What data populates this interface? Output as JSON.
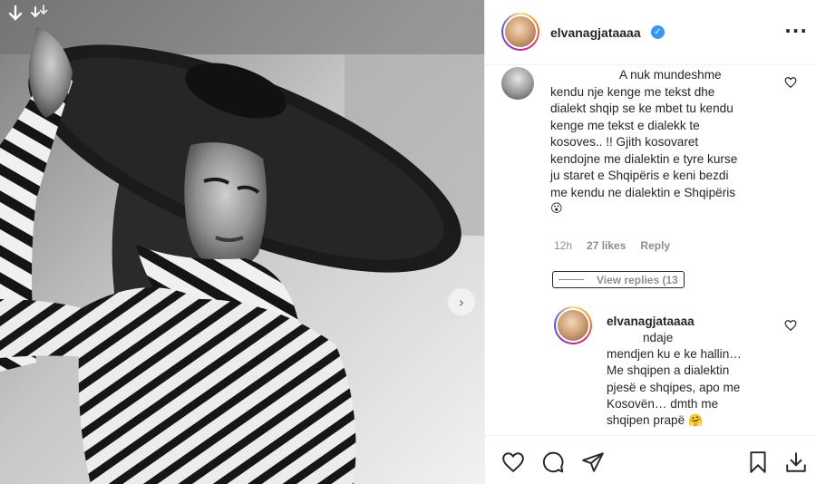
{
  "post": {
    "username": "elvanagjataaaa",
    "verified_icon": "verified-badge-icon",
    "more_icon": "more-options-icon"
  },
  "photo": {
    "top_icons": [
      "download-arrow-icon",
      "multiple-arrows-icon"
    ],
    "next_icon": "next-chevron-icon"
  },
  "comment": {
    "lines": [
      "A nuk mundeshme",
      "kendu nje kenge me tekst dhe",
      "dialekt shqip se ke mbet tu kendu",
      "kenge me tekst e dialekk te",
      "kosoves.. !! Gjith kosovaret",
      "kendojne me dialektin e tyre kurse",
      "ju staret e Shqipëris e keni bezdi",
      "me kendu ne dialektin e Shqipëris"
    ],
    "emoji": "😮",
    "time": "12h",
    "likes": "27 likes",
    "reply_label": "Reply",
    "view_replies": "View replies (13"
  },
  "reply": {
    "username": "elvanagjataaaa",
    "lines": [
      "ndaje",
      "mendjen ku e ke hallin…",
      "Me shqipen a dialektin",
      "pjesë e shqipes, apo me",
      "Kosovën… dmth me"
    ],
    "last_line": "shqipen prapë",
    "emoji": "🤗"
  },
  "actions": {
    "icons": [
      "like-heart-icon",
      "comment-bubble-icon",
      "share-paper-plane-icon",
      "save-bookmark-icon",
      "download-icon"
    ]
  }
}
